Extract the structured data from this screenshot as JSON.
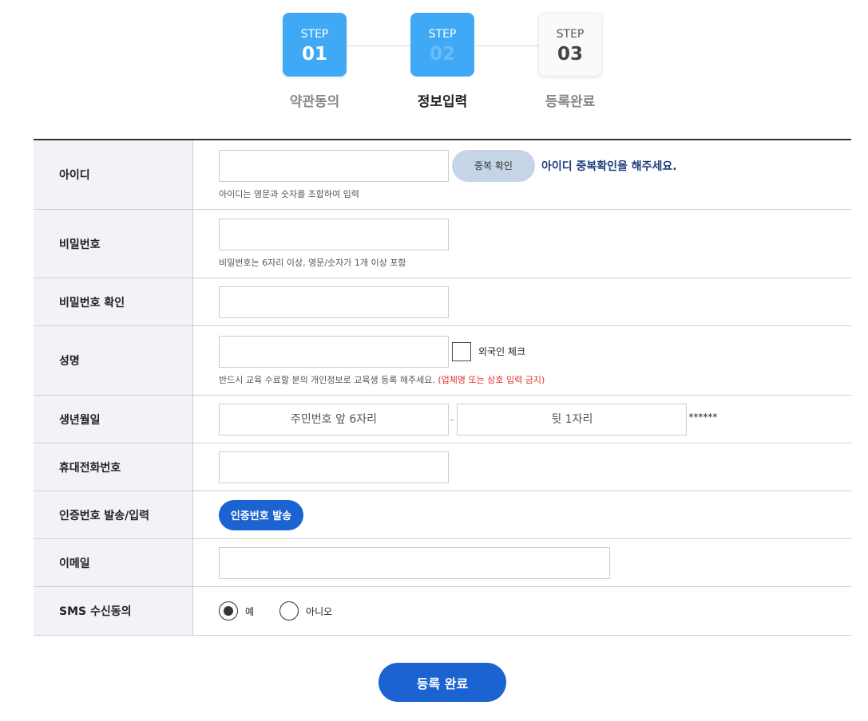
{
  "steps": [
    {
      "label": "STEP",
      "number": "01",
      "caption": "약관동의",
      "state": "done",
      "caption_color": "#888888"
    },
    {
      "label": "STEP",
      "number": "02",
      "caption": "정보입력",
      "state": "current",
      "caption_color": "#222222"
    },
    {
      "label": "STEP",
      "number": "03",
      "caption": "등록완료",
      "state": "pending",
      "caption_color": "#888888"
    }
  ],
  "form": {
    "id": {
      "label": "아이디",
      "value": "",
      "dup_button": "중복 확인",
      "dup_message": "아이디 중복확인을 해주세요.",
      "hint": "아이디는 영문과 숫자를 조합하여 입력"
    },
    "password": {
      "label": "비밀번호",
      "value": "",
      "hint": "비밀번호는 6자리 이상, 영문/숫자가 1개 이상 포함"
    },
    "password_confirm": {
      "label": "비밀번호 확인",
      "value": ""
    },
    "name": {
      "label": "성명",
      "value": "",
      "foreigner_label": "외국인 체크",
      "foreigner_checked": false,
      "hint": "반드시 교육 수료할 분의 개인정보로 교육생 등록 해주세요.",
      "hint_warning": "(업체명 또는 상호 입력 금지)"
    },
    "birth": {
      "label": "생년월일",
      "front_placeholder": "주민번호 앞 6자리",
      "separator": "-",
      "back_placeholder": "뒷 1자리",
      "mask": "******"
    },
    "phone": {
      "label": "휴대전화번호",
      "value": ""
    },
    "auth": {
      "label": "인증번호 발송/입력",
      "button": "인증번호 발송"
    },
    "email": {
      "label": "이메일",
      "value": ""
    },
    "sms": {
      "label": "SMS 수신동의",
      "options": [
        {
          "label": "예",
          "selected": true
        },
        {
          "label": "아니오",
          "selected": false
        }
      ]
    }
  },
  "submit_label": "등록 완료",
  "colors": {
    "accent": "#1a63d0",
    "step_blue": "#3fa9f5",
    "dup_button_bg": "#c5d5e7",
    "dup_message": "#1e3d7a",
    "warning": "#e0322b",
    "label_bg": "#f1f3f6"
  }
}
